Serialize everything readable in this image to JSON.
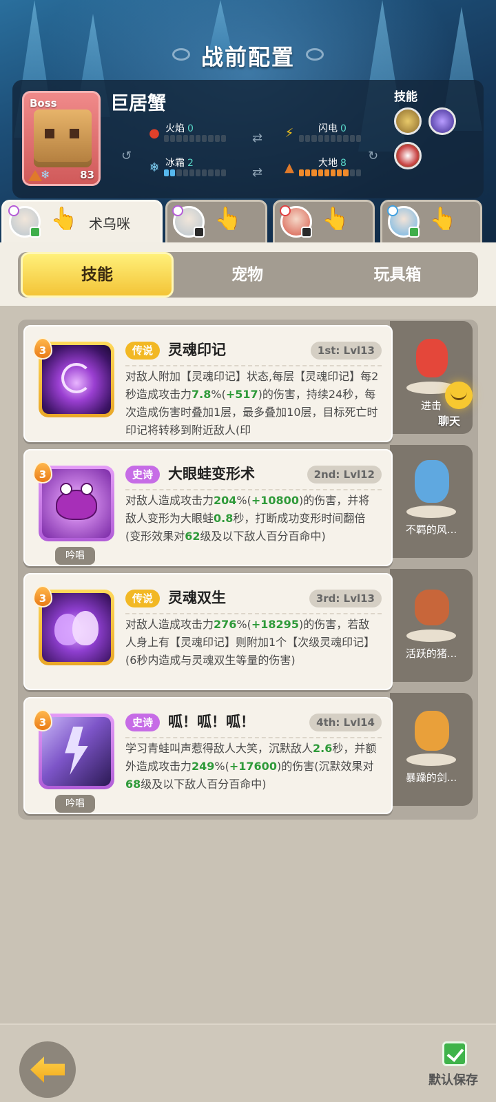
{
  "page_title": "战前配置",
  "boss": {
    "tag": "Boss",
    "name": "巨居蟹",
    "level": "83",
    "skills_label": "技能",
    "stats": {
      "fire": {
        "label": "火焰",
        "value": "0",
        "filled": 0
      },
      "lightning": {
        "label": "闪电",
        "value": "0",
        "filled": 0
      },
      "frost": {
        "label": "冰霜",
        "value": "2",
        "filled": 2
      },
      "earth": {
        "label": "大地",
        "value": "8",
        "filled": 8
      }
    }
  },
  "heroes": [
    {
      "name": "术乌咪",
      "active": true
    },
    {
      "name": "",
      "active": false
    },
    {
      "name": "",
      "active": false
    },
    {
      "name": "",
      "active": false
    }
  ],
  "menu_tabs": [
    "技能",
    "宠物",
    "玩具箱"
  ],
  "skills": [
    {
      "level": "3",
      "rarity": "传说",
      "name": "灵魂印记",
      "order": "1st: Lvl13",
      "desc_parts": [
        {
          "t": "对敌人附加【灵魂印记】状态,每层【灵魂印记】每2秒造成攻击力"
        },
        {
          "t": "7.8",
          "h": true
        },
        {
          "t": "%("
        },
        {
          "t": "+517",
          "h": true
        },
        {
          "t": ")的伤害，持续24秒，每次造成伤害时叠加1层，最多叠加10层，目标死亡时印记将转移到附近敌人(印"
        }
      ]
    },
    {
      "level": "3",
      "rarity": "史诗",
      "name": "大眼蛙变形术",
      "order": "2nd: Lvl12",
      "chant": "吟唱",
      "desc_parts": [
        {
          "t": "对敌人造成攻击力"
        },
        {
          "t": "204",
          "h": true
        },
        {
          "t": "%("
        },
        {
          "t": "+10800",
          "h": true
        },
        {
          "t": ")的伤害，并将敌人变形为大眼蛙"
        },
        {
          "t": "0.8",
          "h": true
        },
        {
          "t": "秒，打断成功变形时间翻倍(变形效果对"
        },
        {
          "t": "62",
          "h": true
        },
        {
          "t": "级及以下敌人百分百命中)"
        }
      ]
    },
    {
      "level": "3",
      "rarity": "传说",
      "name": "灵魂双生",
      "order": "3rd: Lvl13",
      "desc_parts": [
        {
          "t": "对敌人造成攻击力"
        },
        {
          "t": "276",
          "h": true
        },
        {
          "t": "%("
        },
        {
          "t": "+18295",
          "h": true
        },
        {
          "t": ")的伤害，若敌人身上有【灵魂印记】则附加1个【次级灵魂印记】(6秒内造成与灵魂双生等量的伤害)"
        }
      ]
    },
    {
      "level": "3",
      "rarity": "史诗",
      "name": "呱！呱！呱！",
      "order": "4th: Lvl14",
      "chant": "吟唱",
      "desc_parts": [
        {
          "t": "学习青蛙叫声惹得敌人大笑，沉默敌人"
        },
        {
          "t": "2.6",
          "h": true
        },
        {
          "t": "秒，并额外造成攻击力"
        },
        {
          "t": "249",
          "h": true
        },
        {
          "t": "%("
        },
        {
          "t": "+17600",
          "h": true
        },
        {
          "t": ")的伤害(沉默效果对"
        },
        {
          "t": "68",
          "h": true
        },
        {
          "t": "级及以下敌人百分百命中)"
        }
      ]
    }
  ],
  "pets": [
    {
      "name": "进击"
    },
    {
      "name": "不羁的风..."
    },
    {
      "name": "活跃的猪..."
    },
    {
      "name": "暴躁的剑..."
    }
  ],
  "chat_label": "聊天",
  "save_label": "默认保存",
  "colors": {
    "highlight": "#2f9a3a",
    "legend": "#f2b824",
    "epic": "#c66ce6"
  }
}
